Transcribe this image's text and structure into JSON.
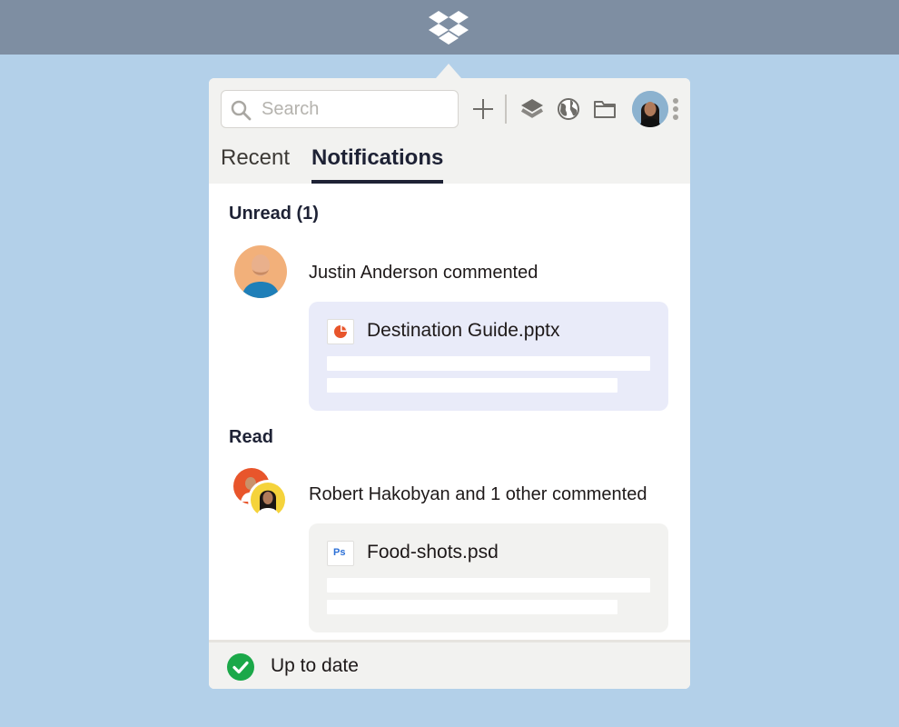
{
  "menubar": {
    "logo_icon": "dropbox-logo"
  },
  "header": {
    "search": {
      "placeholder": "Search",
      "value": ""
    },
    "tools": [
      "plus-icon",
      "layers-icon",
      "globe-icon",
      "folder-icon"
    ],
    "avatar": "user-avatar"
  },
  "tabs": [
    {
      "label": "Recent",
      "active": false
    },
    {
      "label": "Notifications",
      "active": true
    }
  ],
  "unread": {
    "title": "Unread (1)",
    "items": [
      {
        "text": "Justin Anderson commented",
        "file": "Destination Guide.pptx",
        "file_icon": "powerpoint-icon",
        "card_color": "#e9ebf9"
      }
    ]
  },
  "read": {
    "title": "Read",
    "items": [
      {
        "text": "Robert Hakobyan and 1 other commented",
        "file": "Food-shots.psd",
        "file_icon": "photoshop-icon",
        "file_icon_text": "Ps",
        "card_color": "#f2f2f0"
      }
    ]
  },
  "footer": {
    "status": "Up to date",
    "status_color": "#1ba849"
  },
  "colors": {
    "menubar": "#7e8ea2",
    "background": "#b3d0e9",
    "accent_orange": "#e8552b",
    "ps_blue": "#2b6fd6"
  }
}
